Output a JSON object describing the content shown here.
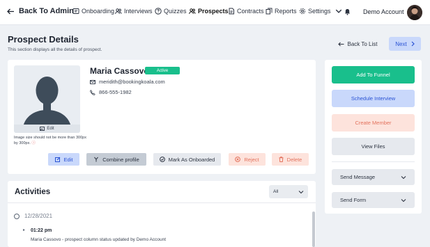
{
  "nav": {
    "back_label": "Back To Admin",
    "items": [
      {
        "label": "Onboarding",
        "icon": "onboarding-icon"
      },
      {
        "label": "Interviews",
        "icon": "interviews-icon"
      },
      {
        "label": "Quizzes",
        "icon": "quizzes-icon"
      },
      {
        "label": "Prospects",
        "icon": "prospects-icon",
        "active": true
      },
      {
        "label": "Contracts",
        "icon": "contracts-icon"
      },
      {
        "label": "Reports",
        "icon": "reports-icon"
      },
      {
        "label": "Settings",
        "icon": "settings-icon"
      }
    ],
    "account_label": "Demo Account"
  },
  "page": {
    "title": "Prospect Details",
    "subtitle": "This section displays all the details of prospect.",
    "back_to_list": "Back To List",
    "next": "Next"
  },
  "profile": {
    "name": "Maria Cassovo",
    "status": "Active",
    "email": "meridith@bookingkoala.com",
    "phone": "866-555-1982",
    "photo_edit": "Edit",
    "image_note": "Image size should not be more than 300px by 300px."
  },
  "actions": {
    "edit": "Edit",
    "combine": "Combine profile",
    "onboard": "Mark As Onboarded",
    "reject": "Reject",
    "delete": "Delete"
  },
  "activities": {
    "title": "Activities",
    "filter": "All",
    "entries": [
      {
        "date": "12/28/2021",
        "time": "01:22 pm",
        "description": "Maria Cassovo - prospect column status updated by Demo Account"
      }
    ]
  },
  "side": {
    "add_to_funnel": "Add To Funnel",
    "schedule_interview": "Schedule Interview",
    "create_member": "Create Member",
    "view_files": "View Files",
    "send_message": "Send Message",
    "send_form": "Send Form"
  },
  "colors": {
    "green": "#19bf8c",
    "blue_light": "#c9d8fb",
    "blue_text": "#2952d4",
    "red_light": "#fde3dc",
    "red_text": "#e3735e",
    "background": "#eef1f5"
  }
}
